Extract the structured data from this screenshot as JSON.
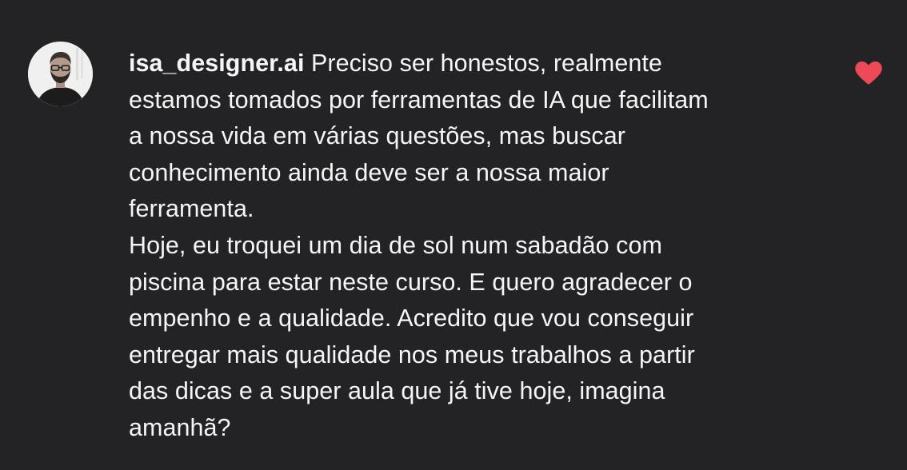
{
  "comment": {
    "avatar_icon": "avatar-photo",
    "username": "isa_designer.ai",
    "first_line": "Preciso ser honestos, realmente",
    "lines": [
      "estamos tomados por ferramentas de IA que facilitam",
      "a nossa vida em várias questões, mas buscar",
      "conhecimento ainda deve ser a nossa maior",
      "ferramenta.",
      "Hoje, eu troquei um dia de sol num sabadão com",
      "piscina para estar neste curso. E quero agradecer o",
      "empenho e a qualidade. Acredito que vou conseguir",
      "entregar mais qualidade nos meus trabalhos a partir",
      "das dicas e a super aula que já tive hoje, imagina",
      "amanhã?"
    ],
    "like_icon": "heart-icon",
    "liked": true,
    "like_color": "#ed4956",
    "text_color": "#f5f5f5",
    "background_color": "#232326"
  }
}
